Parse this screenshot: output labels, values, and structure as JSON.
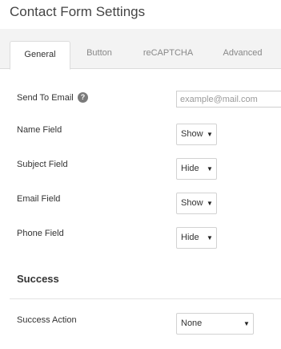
{
  "page": {
    "title": "Contact Form Settings"
  },
  "tabs": [
    {
      "label": "General",
      "active": true
    },
    {
      "label": "Button"
    },
    {
      "label": "reCAPTCHA"
    },
    {
      "label": "Advanced"
    }
  ],
  "general": {
    "send_to_email": {
      "label": "Send To Email",
      "help_icon": "question-circle-icon",
      "value": "",
      "placeholder": "example@mail.com"
    },
    "name_field": {
      "label": "Name Field",
      "value": "Show"
    },
    "subject_field": {
      "label": "Subject Field",
      "value": "Hide"
    },
    "email_field": {
      "label": "Email Field",
      "value": "Show"
    },
    "phone_field": {
      "label": "Phone Field",
      "value": "Hide"
    }
  },
  "success": {
    "title": "Success",
    "action": {
      "label": "Success Action",
      "value": "None"
    }
  },
  "icons": {
    "dropdown_arrow": "▼",
    "help": "?"
  }
}
